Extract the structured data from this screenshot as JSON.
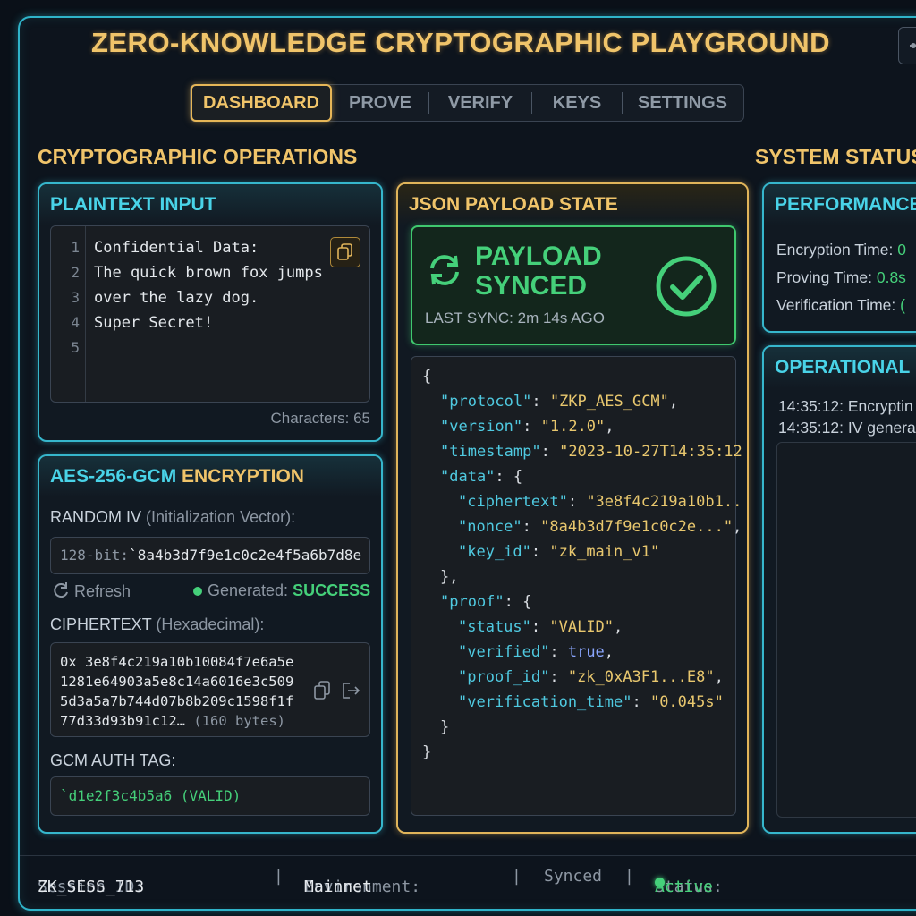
{
  "app": {
    "title": "ZERO-KNOWLEDGE CRYPTOGRAPHIC PLAYGROUND",
    "tabs": [
      "DASHBOARD",
      "PROVE",
      "VERIFY",
      "KEYS",
      "SETTINGS"
    ],
    "active_tab": "DASHBOARD"
  },
  "left": {
    "section_title": "CRYPTOGRAPHIC OPERATIONS",
    "plaintext": {
      "title": "PLAINTEXT INPUT",
      "line_numbers": [
        "1",
        "2",
        "3",
        "4",
        "5"
      ],
      "lines": [
        "Confidential Data:",
        "The quick brown fox jumps",
        "over the lazy dog.",
        "Super Secret!",
        ""
      ],
      "char_count": "Characters: 65"
    },
    "aes": {
      "title_a": "AES-256-GCM",
      "title_b": " ENCRYPTION",
      "iv_label_a": "RANDOM IV",
      "iv_label_b": " (Initialization Vector):",
      "iv_prefix": "128-bit:",
      "iv_value": "`8a4b3d7f9e1c0c2e4f5a6b7d8e",
      "refresh_label": "Refresh",
      "generated_label": "Generated:",
      "generated_value": "SUCCESS",
      "cipher_label_a": "CIPHERTEXT",
      "cipher_label_b": " (Hexadecimal):",
      "cipher_lines": [
        "0x 3e8f4c219a10b10084f7e6a5e",
        "1281e64903a5e8c14a6016e3c509",
        "5d3a5a7b744d07b8b209c1598f1f",
        "77d33d93b91c12…"
      ],
      "cipher_bytes": "(160 bytes)",
      "tag_label": "GCM AUTH TAG:",
      "tag_value": "`d1e2f3c4b5a6 (VALID)"
    }
  },
  "middle": {
    "panel_title": "JSON PAYLOAD STATE",
    "sync": {
      "line1": "PAYLOAD",
      "line2": "SYNCED",
      "last_sync": "LAST SYNC: 2m 14s AGO"
    },
    "json": {
      "protocol_key": "\"protocol\"",
      "protocol_val": "\"ZKP_AES_GCM\"",
      "version_key": "\"version\"",
      "version_val": "\"1.2.0\"",
      "timestamp_key": "\"timestamp\"",
      "timestamp_val": "\"2023-10-27T14:35:12",
      "data_key": "\"data\"",
      "ciphertext_key": "\"ciphertext\"",
      "ciphertext_val": "\"3e8f4c219a10b1..",
      "nonce_key": "\"nonce\"",
      "nonce_val": "\"8a4b3d7f9e1c0c2e...\"",
      "key_id_key": "\"key_id\"",
      "key_id_val": "\"zk_main_v1\"",
      "proof_key": "\"proof\"",
      "status_key": "\"status\"",
      "status_val": "\"VALID\"",
      "verified_key": "\"verified\"",
      "verified_val": "true",
      "proof_id_key": "\"proof_id\"",
      "proof_id_val": "\"zk_0xA3F1...E8\"",
      "vtime_key": "\"verification_time\"",
      "vtime_val": "\"0.045s\""
    }
  },
  "right": {
    "section_title": "SYSTEM STATUS",
    "performance": {
      "title": "PERFORMANCE",
      "enc_label": "Encryption Time:",
      "enc_value": "0",
      "prove_label": "Proving Time:",
      "prove_value": "0.8s",
      "verify_label": "Verification Time:",
      "verify_value": "("
    },
    "log": {
      "title": "OPERATIONAL L",
      "entries": [
        "14:35:12: Encryptin",
        "14:35:12: IV genera"
      ]
    }
  },
  "status_bar": {
    "session_label": "Session ID:",
    "session_value": "ZK_SESS_713",
    "env_label": "Environment:",
    "env_value": "Mainnet",
    "synced": "Synced",
    "status_label": "Status:",
    "status_value": "Active",
    "sep": "|"
  },
  "colors": {
    "accent_cyan": "#36b6cc",
    "accent_gold": "#e0b45a",
    "success_green": "#45d07a",
    "background": "#0a1018"
  }
}
